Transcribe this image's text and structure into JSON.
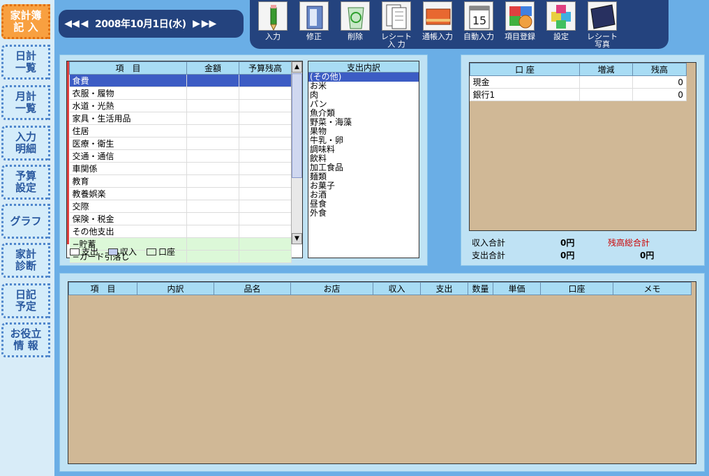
{
  "sidebar": {
    "items": [
      {
        "label": "家計簿\n記 入",
        "active": true
      },
      {
        "label": "日計\n一覧",
        "active": false
      },
      {
        "label": "月計\n一覧",
        "active": false
      },
      {
        "label": "入力\n明細",
        "active": false
      },
      {
        "label": "予算\n設定",
        "active": false
      },
      {
        "label": "グラフ",
        "active": false
      },
      {
        "label": "家計\n診断",
        "active": false
      },
      {
        "label": "日記\n予定",
        "active": false
      },
      {
        "label": "お役立\n情 報",
        "active": false
      }
    ]
  },
  "date_bar": {
    "prev_fast": "◀◀",
    "prev": "◀",
    "date": "2008年10月1日(水)",
    "next": "▶",
    "next_fast": "▶▶"
  },
  "toolbar": {
    "items": [
      {
        "label": "入力",
        "icon": "pencil-icon"
      },
      {
        "label": "修正",
        "icon": "edit-icon"
      },
      {
        "label": "削除",
        "icon": "trash-icon"
      },
      {
        "label": "レシート\n入 力",
        "icon": "receipt-icon"
      },
      {
        "label": "通帳入力",
        "icon": "bankbook-icon"
      },
      {
        "label": "自動入力",
        "icon": "calendar-icon"
      },
      {
        "label": "項目登録",
        "icon": "register-icon"
      },
      {
        "label": "設定",
        "icon": "settings-cube-icon"
      },
      {
        "label": "レシート\n写真",
        "icon": "photo-icon"
      }
    ]
  },
  "category_table": {
    "headers": [
      "項　目",
      "金額",
      "予算残高"
    ],
    "rows": [
      {
        "name": "食費",
        "type": "selected"
      },
      {
        "name": "衣服・履物",
        "type": "normal"
      },
      {
        "name": "水道・光熱",
        "type": "normal"
      },
      {
        "name": "家具・生活用品",
        "type": "normal"
      },
      {
        "name": "住居",
        "type": "normal"
      },
      {
        "name": "医療・衛生",
        "type": "normal"
      },
      {
        "name": "交通・通信",
        "type": "normal"
      },
      {
        "name": "車関係",
        "type": "normal"
      },
      {
        "name": "教育",
        "type": "normal"
      },
      {
        "name": "教養娯楽",
        "type": "normal"
      },
      {
        "name": "交際",
        "type": "normal"
      },
      {
        "name": "保険・税金",
        "type": "normal"
      },
      {
        "name": "その他支出",
        "type": "normal"
      },
      {
        "name": "−貯蓄",
        "type": "green"
      },
      {
        "name": "−カード引落し",
        "type": "green"
      }
    ],
    "legend": [
      {
        "label": "支出",
        "color": "#ffffff"
      },
      {
        "label": "収入",
        "color": "#c0ccf0"
      },
      {
        "label": "口座",
        "color": "#dcf8d8"
      }
    ]
  },
  "subcategory_list": {
    "header": "支出内訳",
    "items": [
      "(その他)",
      "お米",
      "肉",
      "パン",
      "魚介類",
      "野菜・海藻",
      "果物",
      "牛乳・卵",
      "調味料",
      "飲料",
      "加工食品",
      "麺類",
      "お菓子",
      "お酒",
      "昼食",
      "外食"
    ],
    "selected_index": 0
  },
  "account_table": {
    "headers": [
      "口 座",
      "増減",
      "残高"
    ],
    "rows": [
      {
        "name": "現金",
        "change": "",
        "balance": "0"
      },
      {
        "name": "銀行1",
        "change": "",
        "balance": "0"
      }
    ]
  },
  "totals": {
    "income_label": "収入合計",
    "income_value": "0円",
    "expense_label": "支出合計",
    "expense_value": "0円",
    "balance_label": "残高総合計",
    "balance_value": "0円"
  },
  "entry_table": {
    "headers": [
      "項　目",
      "内訳",
      "品名",
      "お店",
      "収入",
      "支出",
      "数量",
      "単価",
      "口座",
      "メモ"
    ]
  },
  "colors": {
    "accent_orange": "#f8a040",
    "navy": "#24437e",
    "tan": "#d0b896",
    "header_blue": "#a8dcf4",
    "selection": "#3c5cc4",
    "red_label": "#cc0000"
  }
}
